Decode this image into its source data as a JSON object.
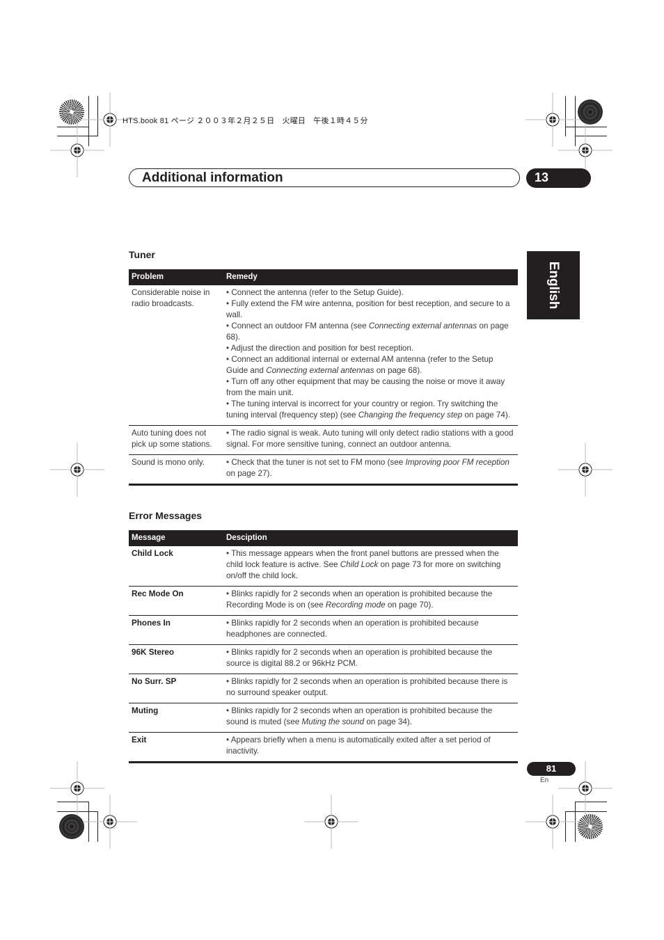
{
  "print_header": "HTS.book  81 ページ  ２００３年２月２５日　火曜日　午後１時４５分",
  "section": {
    "title": "Additional information",
    "chapter": "13"
  },
  "language_tab": "English",
  "tuner": {
    "heading": "Tuner",
    "columns": [
      "Problem",
      "Remedy"
    ],
    "rows": [
      {
        "problem": "Considerable noise in radio broadcasts.",
        "remedies": [
          [
            {
              "t": "• Connect the antenna (refer to the Setup Guide)."
            }
          ],
          [
            {
              "t": "• Fully extend the FM wire antenna, position for best reception, and secure to a wall."
            }
          ],
          [
            {
              "t": "• Connect an outdoor FM antenna (see "
            },
            {
              "t": "Connecting external antennas",
              "i": true
            },
            {
              "t": " on page 68)."
            }
          ],
          [
            {
              "t": "• Adjust the direction and position for best reception."
            }
          ],
          [
            {
              "t": "• Connect an additional internal or external AM antenna (refer to the Setup Guide and "
            },
            {
              "t": "Connecting external antennas",
              "i": true
            },
            {
              "t": " on page 68)."
            }
          ],
          [
            {
              "t": "• Turn off any other equipment that may be causing the noise or move it away from the main unit."
            }
          ],
          [
            {
              "t": "• The tuning interval is incorrect for your country or region. Try switching the tuning interval (frequency step) (see "
            },
            {
              "t": "Changing the frequency step",
              "i": true
            },
            {
              "t": " on page 74)."
            }
          ]
        ]
      },
      {
        "problem": "Auto tuning does not pick up some stations.",
        "remedies": [
          [
            {
              "t": "• The radio signal is weak. Auto tuning will only detect radio stations with a good signal. For more sensitive tuning, connect an outdoor antenna."
            }
          ]
        ]
      },
      {
        "problem": "Sound is mono only.",
        "remedies": [
          [
            {
              "t": "• Check that the tuner is not set to FM mono (see "
            },
            {
              "t": "Improving poor FM reception",
              "i": true
            },
            {
              "t": " on page 27)."
            }
          ]
        ]
      }
    ]
  },
  "errors": {
    "heading": "Error Messages",
    "columns": [
      "Message",
      "Desciption"
    ],
    "rows": [
      {
        "message": "Child Lock",
        "desc": [
          {
            "t": "• This message appears when the front panel buttons are pressed when the child lock feature is active. See "
          },
          {
            "t": "Child Lock",
            "i": true
          },
          {
            "t": " on page 73 for more on switching on/off the child lock."
          }
        ]
      },
      {
        "message": "Rec Mode On",
        "desc": [
          {
            "t": "• Blinks rapidly for 2 seconds when an operation is prohibited because the Recording Mode is on (see "
          },
          {
            "t": "Recording mode",
            "i": true
          },
          {
            "t": " on page 70)."
          }
        ]
      },
      {
        "message": "Phones In",
        "desc": [
          {
            "t": "• Blinks rapidly for 2 seconds when an operation is prohibited because headphones are connected."
          }
        ]
      },
      {
        "message": "96K Stereo",
        "desc": [
          {
            "t": "• Blinks rapidly for 2 seconds when an operation is prohibited because the source is digital 88.2 or 96kHz PCM."
          }
        ]
      },
      {
        "message": "No Surr. SP",
        "desc": [
          {
            "t": "• Blinks rapidly for 2 seconds when an operation is prohibited because there is no surround speaker output."
          }
        ]
      },
      {
        "message": "Muting",
        "desc": [
          {
            "t": "• Blinks rapidly for 2 seconds when an operation is prohibited because the sound is muted (see "
          },
          {
            "t": "Muting the sound",
            "i": true
          },
          {
            "t": " on page 34)."
          }
        ]
      },
      {
        "message": "Exit",
        "desc": [
          {
            "t": "• Appears briefly when a menu is automatically exited after a set period of inactivity."
          }
        ]
      }
    ]
  },
  "footer": {
    "page_number": "81",
    "language_code": "En"
  }
}
